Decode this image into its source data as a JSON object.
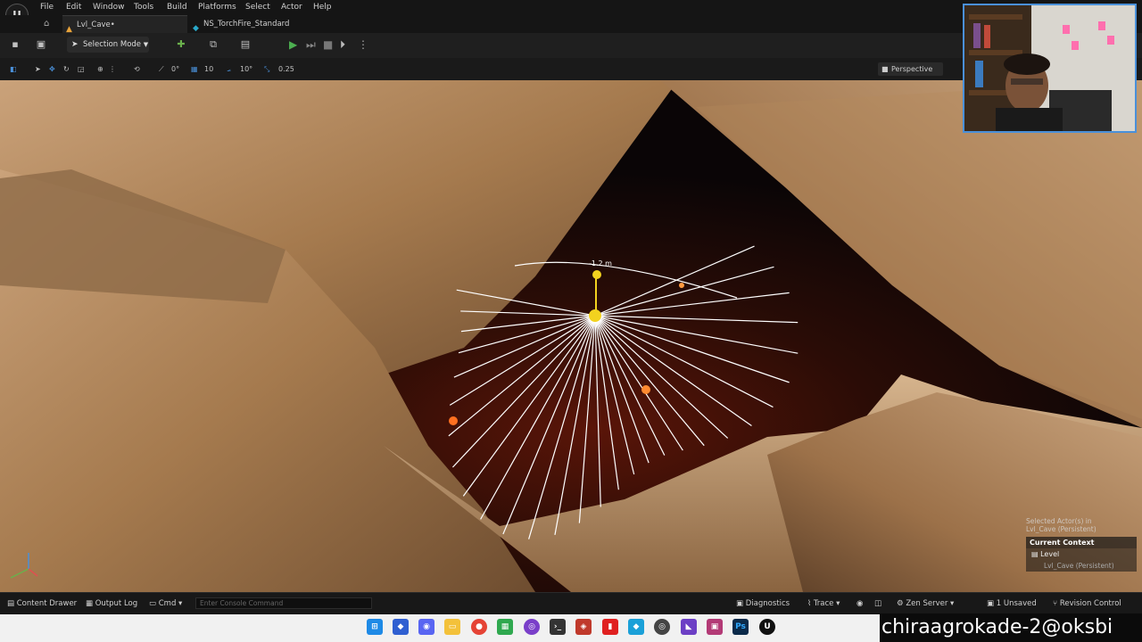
{
  "menu": [
    "File",
    "Edit",
    "Window",
    "Tools",
    "Build",
    "Platforms",
    "Select",
    "Actor",
    "Help"
  ],
  "tabs": [
    {
      "label": "Lvl_Cave•"
    },
    {
      "label": "NS_TorchFire_Standard"
    }
  ],
  "toolbar": {
    "selection_mode": "Selection Mode"
  },
  "viewport_toolbar": {
    "rotate_snap": "0°",
    "grid_snap": "10",
    "angle_snap": "10°",
    "scale_snap": "0.25",
    "view_mode": "Perspective"
  },
  "viewport": {
    "distance_label": "-1.2 m"
  },
  "context_panel": {
    "selected_actor_line1": "Selected Actor(s) in",
    "selected_actor_line2": "Lvl_Cave (Persistent)",
    "current_context": "Current Context",
    "level": "Level",
    "level_value": "Lvl_Cave (Persistent)"
  },
  "statusbar": {
    "content_drawer": "Content Drawer",
    "output_log": "Output Log",
    "cmd": "Cmd",
    "console_placeholder": "Enter Console Command",
    "diagnostics": "Diagnostics",
    "trace": "Trace",
    "zen_server": "Zen Server",
    "unsaved": "1 Unsaved",
    "revision_control": "Revision Control"
  },
  "watermark": "chiraagrokade-2@oksbi",
  "colors": {
    "accent": "#4a90d9",
    "play": "#4caf50",
    "gizmo": "#f2d21f",
    "rock": "#b48a5c"
  }
}
